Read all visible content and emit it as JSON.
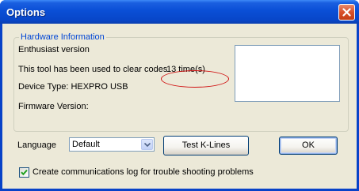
{
  "window": {
    "title": "Options"
  },
  "hardware": {
    "group_label": "Hardware Information",
    "edition": "Enthusiast version",
    "usage_prefix": "This tool has been used to clear codes",
    "usage_count": "13 time(s)",
    "device_type": "Device Type: HEXPRO USB",
    "firmware": "Firmware Version:"
  },
  "language": {
    "label": "Language",
    "selected": "Default"
  },
  "buttons": {
    "test_klines": "Test K-Lines",
    "ok": "OK"
  },
  "log_option": {
    "label": "Create communications log for trouble shooting problems",
    "checked": true
  },
  "colors": {
    "titlebar": "#0a4fd6",
    "dialog_bg": "#ece9d8",
    "group_label": "#0046d5",
    "highlight_oval": "#d01010",
    "close_button": "#d9502a"
  },
  "icons": {
    "close": "close-icon",
    "dropdown": "chevron-down-icon",
    "check": "checkmark-icon"
  }
}
